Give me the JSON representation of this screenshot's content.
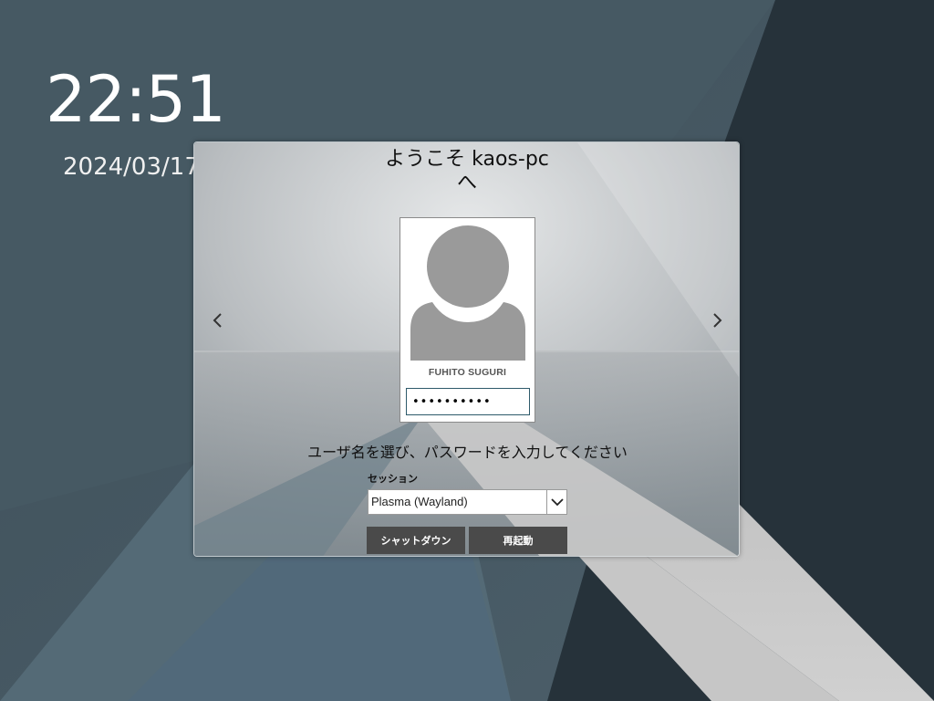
{
  "clock": {
    "time": "22:51",
    "date": "2024/03/17"
  },
  "greeter": {
    "welcome_line1": "ようこそ kaos-pc",
    "welcome_line2": "へ",
    "prev_icon": "chevron-left-icon",
    "next_icon": "chevron-right-icon"
  },
  "user": {
    "name": "FUHITO SUGURI",
    "avatar_icon": "user-avatar-icon",
    "password_value": "••••••••••"
  },
  "prompt": "ユーザ名を選び、パスワードを入力してください",
  "session": {
    "label": "セッション",
    "selected": "Plasma (Wayland)",
    "dropdown_icon": "chevron-down-icon"
  },
  "buttons": {
    "shutdown": "シャットダウン",
    "reboot": "再起動"
  },
  "colors": {
    "background": "#4a5d68",
    "button": "#4a4a4a",
    "input_border": "#2e5a6a"
  }
}
